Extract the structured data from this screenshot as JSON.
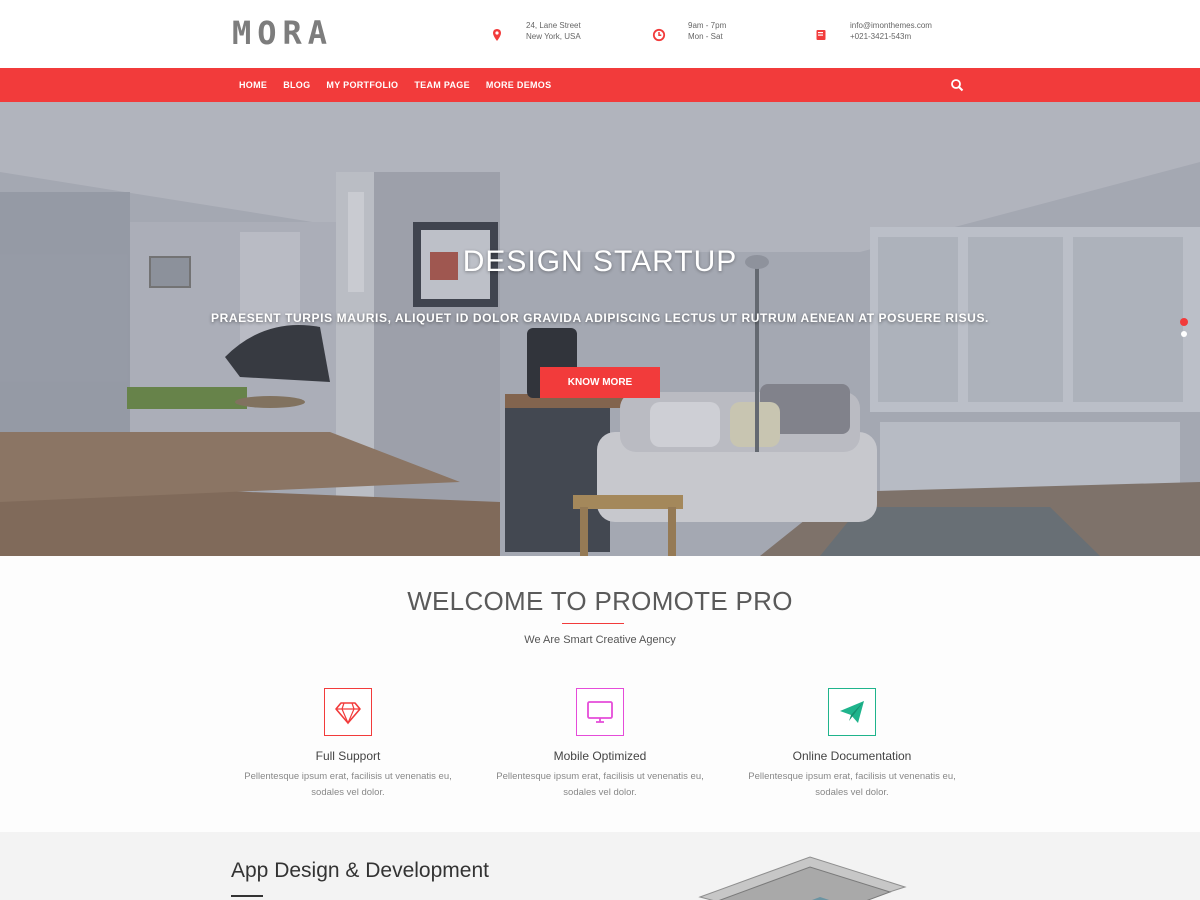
{
  "header": {
    "logo": "MORA",
    "address": {
      "line1": "24, Lane Street",
      "line2": "New York, USA",
      "icon": "map-pin-icon"
    },
    "hours": {
      "line1": "9am - 7pm",
      "line2": "Mon - Sat",
      "icon": "clock-icon"
    },
    "contact": {
      "line1": "info@imonthemes.com",
      "line2": "+021-3421-543m",
      "icon": "book-icon"
    }
  },
  "nav": {
    "items": [
      "HOME",
      "BLOG",
      "MY PORTFOLIO",
      "TEAM PAGE",
      "MORE DEMOS"
    ],
    "search_icon": "search-icon"
  },
  "hero": {
    "title": "DESIGN STARTUP",
    "subtitle": "PRAESENT TURPIS MAURIS, ALIQUET ID DOLOR GRAVIDA ADIPISCING LECTUS UT RUTRUM AENEAN AT POSUERE RISUS.",
    "button": "KNOW MORE"
  },
  "welcome": {
    "title": "WELCOME TO PROMOTE PRO",
    "subtitle": "We Are Smart Creative Agency",
    "features": [
      {
        "title": "Full Support",
        "desc1": "Pellentesque ipsum erat, facilisis ut venenatis eu,",
        "desc2": "sodales vel dolor.",
        "icon": "diamond-icon",
        "color": "#f23b3b"
      },
      {
        "title": "Mobile Optimized",
        "desc1": "Pellentesque ipsum erat, facilisis ut venenatis eu,",
        "desc2": "sodales vel dolor.",
        "icon": "monitor-icon",
        "color": "#e54cd9"
      },
      {
        "title": "Online Documentation",
        "desc1": "Pellentesque ipsum erat, facilisis ut venenatis eu,",
        "desc2": "sodales vel dolor.",
        "icon": "paper-plane-icon",
        "color": "#1fb48c"
      }
    ]
  },
  "app_section": {
    "title": "App Design & Development"
  },
  "colors": {
    "accent": "#f23b3b"
  }
}
